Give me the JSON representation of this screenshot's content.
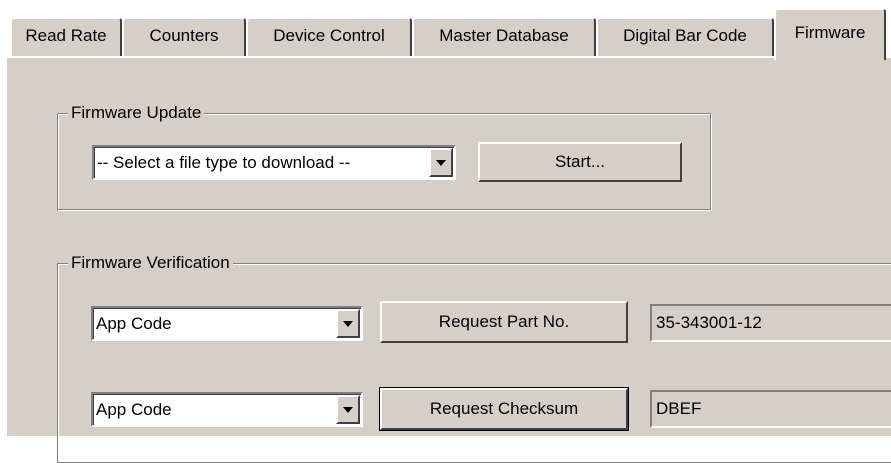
{
  "tabs": [
    {
      "label": "Read Rate",
      "active": false
    },
    {
      "label": "Counters",
      "active": false
    },
    {
      "label": "Device Control",
      "active": false
    },
    {
      "label": "Master Database",
      "active": false
    },
    {
      "label": "Digital Bar Code",
      "active": false
    },
    {
      "label": "Firmware",
      "active": true
    }
  ],
  "firmware_update": {
    "title": "Firmware Update",
    "file_type_select": "-- Select a file type to download --",
    "start_button": "Start..."
  },
  "firmware_verification": {
    "title": "Firmware Verification",
    "rows": [
      {
        "select": "App Code",
        "button": "Request Part No.",
        "result": "35-343001-12"
      },
      {
        "select": "App Code",
        "button": "Request Checksum",
        "result": "DBEF"
      }
    ]
  },
  "colors": {
    "face": "#d4d0c8",
    "highlight": "#ffffff",
    "shadow": "#808080",
    "dark_shadow": "#404040"
  }
}
